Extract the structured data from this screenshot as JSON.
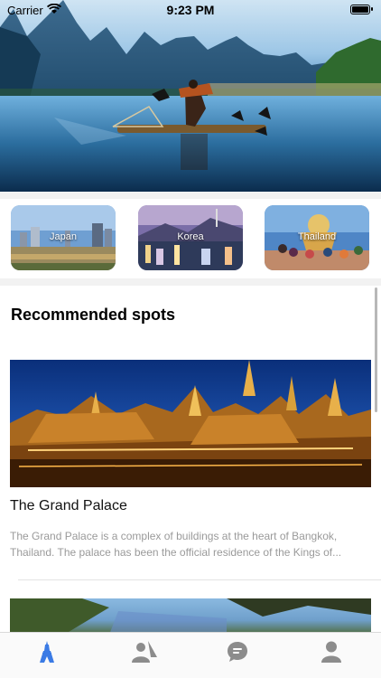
{
  "status_bar": {
    "carrier": "Carrier",
    "time": "9:23 PM"
  },
  "destinations": [
    {
      "label": "Japan"
    },
    {
      "label": "Korea"
    },
    {
      "label": "Thailand"
    }
  ],
  "recommended": {
    "title": "Recommended spots",
    "spots": [
      {
        "name": "The Grand Palace",
        "description_line1": "The Grand Palace is a complex of buildings at the heart of Bangkok,",
        "description_line2": "Thailand. The palace has been the official residence of the Kings of..."
      }
    ]
  },
  "tab_bar": {
    "active_color": "#3b7be5",
    "inactive_color": "#8c8c8c",
    "tabs": [
      {
        "icon": "tower-icon",
        "active": true
      },
      {
        "icon": "people-icon",
        "active": false
      },
      {
        "icon": "chat-icon",
        "active": false
      },
      {
        "icon": "profile-icon",
        "active": false
      }
    ]
  }
}
